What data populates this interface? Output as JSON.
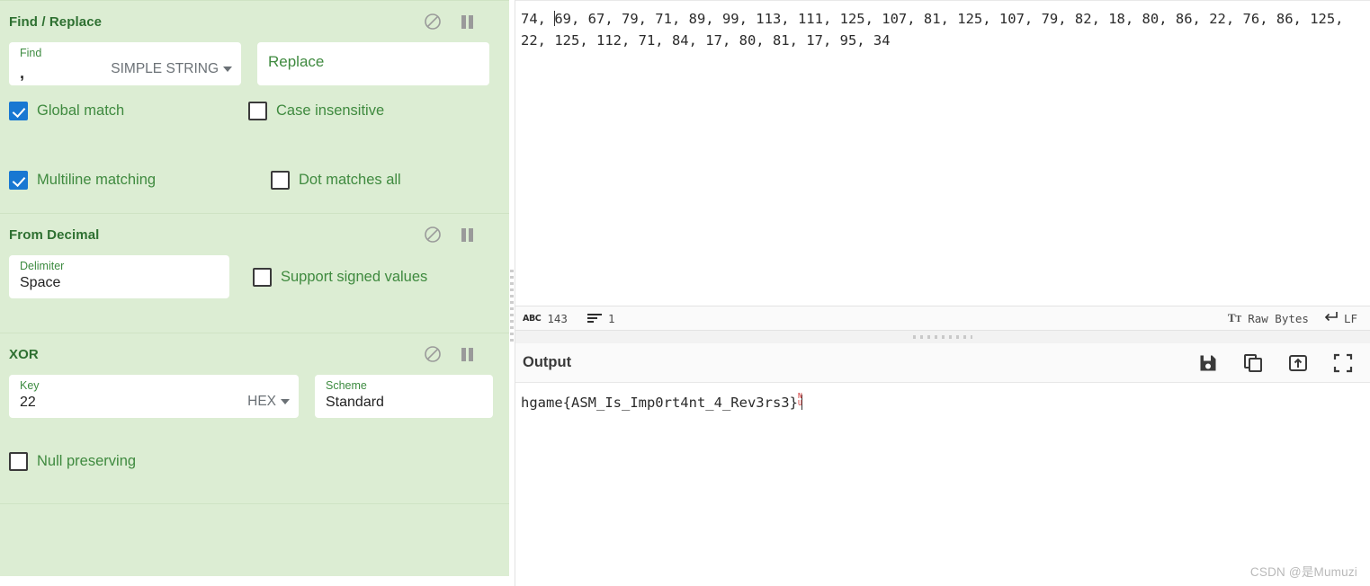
{
  "recipe": {
    "operations": [
      {
        "title": "Find / Replace",
        "controls": {
          "disable": "disable-icon",
          "pause": "pause-icon"
        },
        "args": [
          {
            "label": "Find",
            "value": ",",
            "dropdown": "SIMPLE STRING"
          },
          {
            "label": "",
            "value": "",
            "placeholder": "Replace"
          }
        ],
        "checkboxes": [
          {
            "label": "Global match",
            "checked": true
          },
          {
            "label": "Case insensitive",
            "checked": false
          },
          {
            "label": "Multiline matching",
            "checked": true
          },
          {
            "label": "Dot matches all",
            "checked": false
          }
        ]
      },
      {
        "title": "From Decimal",
        "controls": {
          "disable": "disable-icon",
          "pause": "pause-icon"
        },
        "args": [
          {
            "label": "Delimiter",
            "value": "Space"
          }
        ],
        "checkboxes": [
          {
            "label": "Support signed values",
            "checked": false
          }
        ]
      },
      {
        "title": "XOR",
        "controls": {
          "disable": "disable-icon",
          "pause": "pause-icon"
        },
        "args": [
          {
            "label": "Key",
            "value": "22",
            "dropdown": "HEX"
          },
          {
            "label": "Scheme",
            "value": "Standard"
          }
        ],
        "checkboxes": [
          {
            "label": "Null preserving",
            "checked": false
          }
        ]
      }
    ]
  },
  "input": {
    "text_before_caret": "74, ",
    "text_after_caret": "69, 67, 79, 71, 89, 99, 113, 111, 125, 107, 81, 125, 107, 79, 82, 18, 80, 86, 22, 76, 86, 125, 22, 125, 112, 71, 84, 17, 80, 81, 17, 95, 34",
    "status": {
      "length_icon": "abc-icon",
      "length": "143",
      "lines_icon": "lines-icon",
      "lines": "1",
      "encoding_icon": "font-size-icon",
      "encoding": "Raw Bytes",
      "line_ending_icon": "return-arrow-icon",
      "line_ending": "LF"
    }
  },
  "output": {
    "title": "Output",
    "icons": [
      {
        "name": "save-icon",
        "label": "Save output to file"
      },
      {
        "name": "copy-icon",
        "label": "Copy raw output to the clipboard"
      },
      {
        "name": "open-in-tab-icon",
        "label": "Replace input with output"
      },
      {
        "name": "maximise-icon",
        "label": "Maximise output pane"
      }
    ],
    "text": "hgame{ASM_Is_Imp0rt4nt_4_Rev3rs3}",
    "trailing_control_char": "NU"
  },
  "watermark": "CSDN @是Mumuzi",
  "colors": {
    "recipe_bg": "#dcedd3",
    "op_title": "#2e7031",
    "label_green": "#3d8b40",
    "checkbox_checked": "#1877d2",
    "control_char_red": "#d03030"
  }
}
